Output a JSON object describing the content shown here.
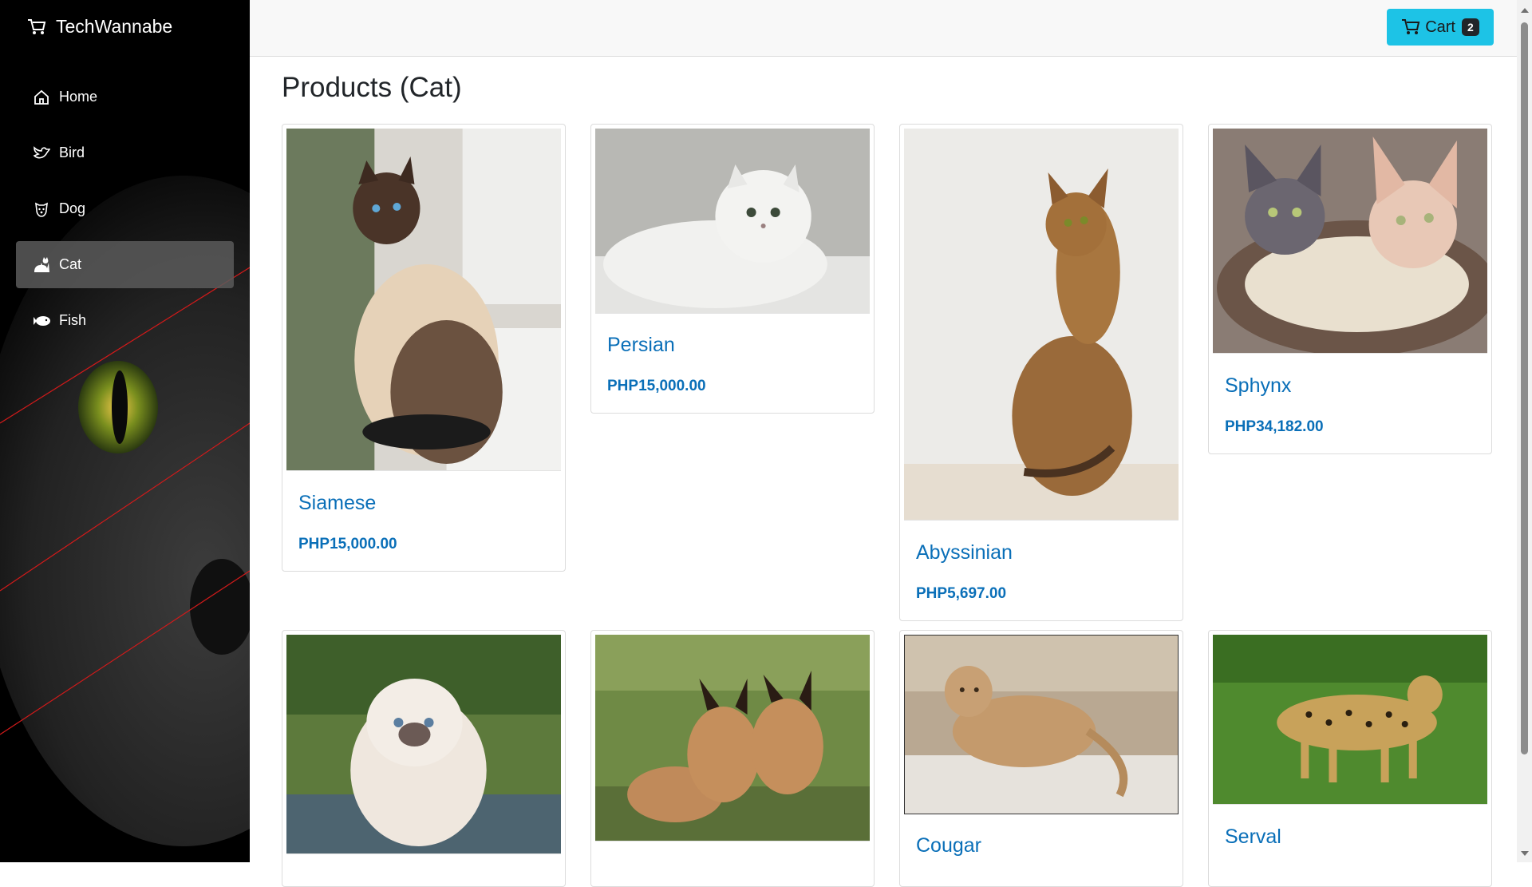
{
  "brand": {
    "name": "TechWannabe",
    "icon": "cart-icon"
  },
  "sidebar": {
    "items": [
      {
        "label": "Home",
        "icon": "home-icon",
        "active": false
      },
      {
        "label": "Bird",
        "icon": "bird-icon",
        "active": false
      },
      {
        "label": "Dog",
        "icon": "dog-icon",
        "active": false
      },
      {
        "label": "Cat",
        "icon": "cat-icon",
        "active": true
      },
      {
        "label": "Fish",
        "icon": "fish-icon",
        "active": false
      }
    ]
  },
  "header": {
    "cart_label": "Cart",
    "cart_count": "2",
    "cart_color": "#1dc3e6"
  },
  "main": {
    "title": "Products (Cat)",
    "products": [
      {
        "name": "Siamese",
        "price": "PHP15,000.00"
      },
      {
        "name": "Persian",
        "price": "PHP15,000.00"
      },
      {
        "name": "Abyssinian",
        "price": "PHP5,697.00"
      },
      {
        "name": "Sphynx",
        "price": "PHP34,182.00"
      },
      {
        "name": "",
        "price": ""
      },
      {
        "name": "",
        "price": ""
      },
      {
        "name": "Cougar",
        "price": ""
      },
      {
        "name": "Serval",
        "price": ""
      }
    ]
  },
  "colors": {
    "link": "#0a6fb8",
    "sidebar_bg": "#000000",
    "active_item": "#5a5a5a"
  }
}
